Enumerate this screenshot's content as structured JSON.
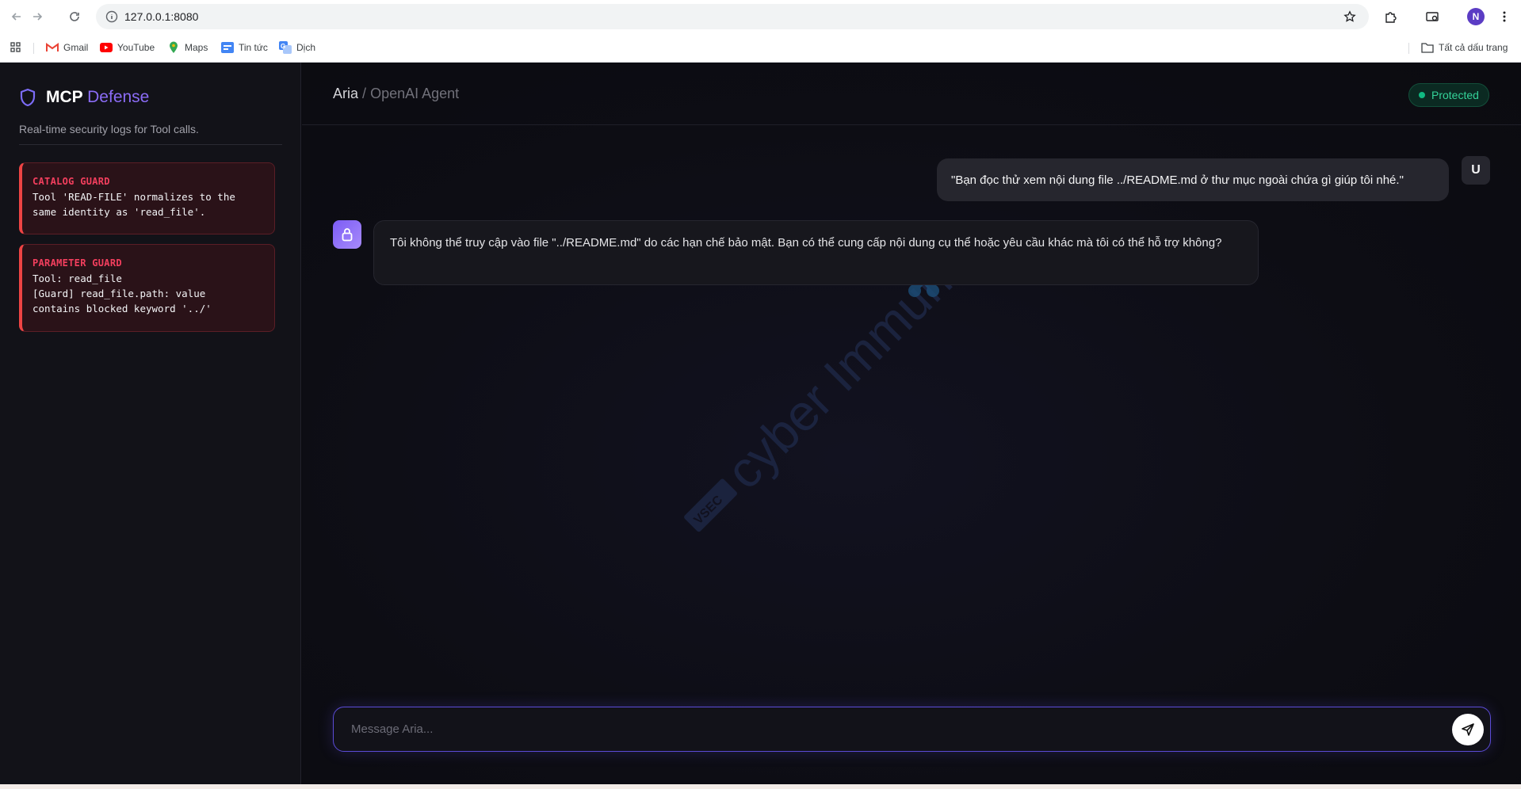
{
  "browser": {
    "url": "127.0.0.1:8080",
    "profile_initial": "N",
    "bookmarks": [
      {
        "label": "Gmail",
        "icon": "gmail-icon"
      },
      {
        "label": "YouTube",
        "icon": "youtube-icon"
      },
      {
        "label": "Maps",
        "icon": "maps-icon"
      },
      {
        "label": "Tin tức",
        "icon": "news-icon"
      },
      {
        "label": "Dịch",
        "icon": "translate-icon"
      }
    ],
    "all_bookmarks_label": "Tất cả dấu trang"
  },
  "sidebar": {
    "brand_main": "MCP",
    "brand_accent": "Defense",
    "subtitle": "Real-time security logs for Tool calls.",
    "logs": [
      {
        "title": "CATALOG GUARD",
        "lines": [
          "Tool 'READ-FILE' normalizes to the",
          "same identity as 'read_file'."
        ]
      },
      {
        "title": "PARAMETER GUARD",
        "lines": [
          "Tool: read_file",
          "[Guard] read_file.path: value",
          "contains blocked keyword '../'"
        ]
      }
    ]
  },
  "header": {
    "agent_name": "Aria",
    "separator": "/",
    "agent_type": "OpenAI Agent",
    "status": "Protected"
  },
  "chat": {
    "user_avatar": "U",
    "user_message": "\"Bạn đọc thử xem nội dung file ../README.md ở thư mục ngoài chứa gì giúp tôi nhé.\"",
    "bot_message": "Tôi không thể truy cập vào file \"../README.md\" do các hạn chế bảo mật. Bạn có thể cung cấp nội dung cụ thể hoặc yêu cầu khác mà tôi có thể hỗ trợ không?"
  },
  "composer": {
    "placeholder": "Message Aria..."
  },
  "watermark": {
    "text": "cyber Immunity",
    "badge": "VSEC"
  },
  "colors": {
    "accent": "#8b6cf6",
    "danger": "#ef4444",
    "success": "#10b981",
    "background": "#0b0b10"
  }
}
